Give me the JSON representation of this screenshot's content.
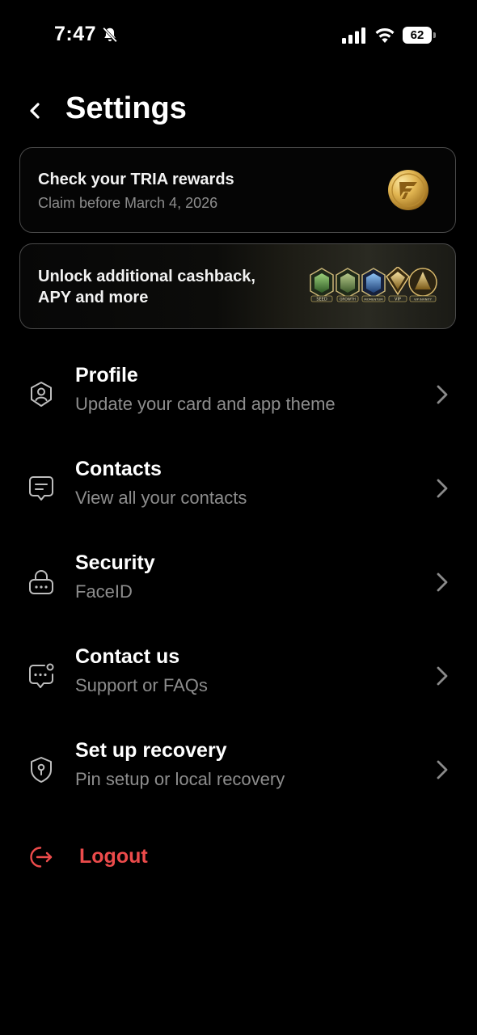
{
  "status_bar": {
    "time": "7:47",
    "battery": "62"
  },
  "header": {
    "title": "Settings"
  },
  "rewards_card": {
    "title": "Check your TRIA rewards",
    "subtitle": "Claim before March 4, 2026"
  },
  "cashback_card": {
    "line1": "Unlock additional cashback,",
    "line2": "APY and more",
    "badges": [
      "SEED",
      "GROWTH",
      "MOMENTUM",
      "VIP",
      "VIP INFINITY"
    ]
  },
  "menu": [
    {
      "label": "Profile",
      "subtitle": "Update your card and app theme",
      "icon": "user-shield-icon"
    },
    {
      "label": "Contacts",
      "subtitle": "View all your contacts",
      "icon": "message-icon"
    },
    {
      "label": "Security",
      "subtitle": "FaceID",
      "icon": "lock-icon"
    },
    {
      "label": "Contact us",
      "subtitle": "Support or FAQs",
      "icon": "chat-dots-icon"
    },
    {
      "label": "Set up recovery",
      "subtitle": "Pin setup or local recovery",
      "icon": "key-shield-icon"
    }
  ],
  "logout": {
    "label": "Logout",
    "color": "#ec4b4b"
  }
}
